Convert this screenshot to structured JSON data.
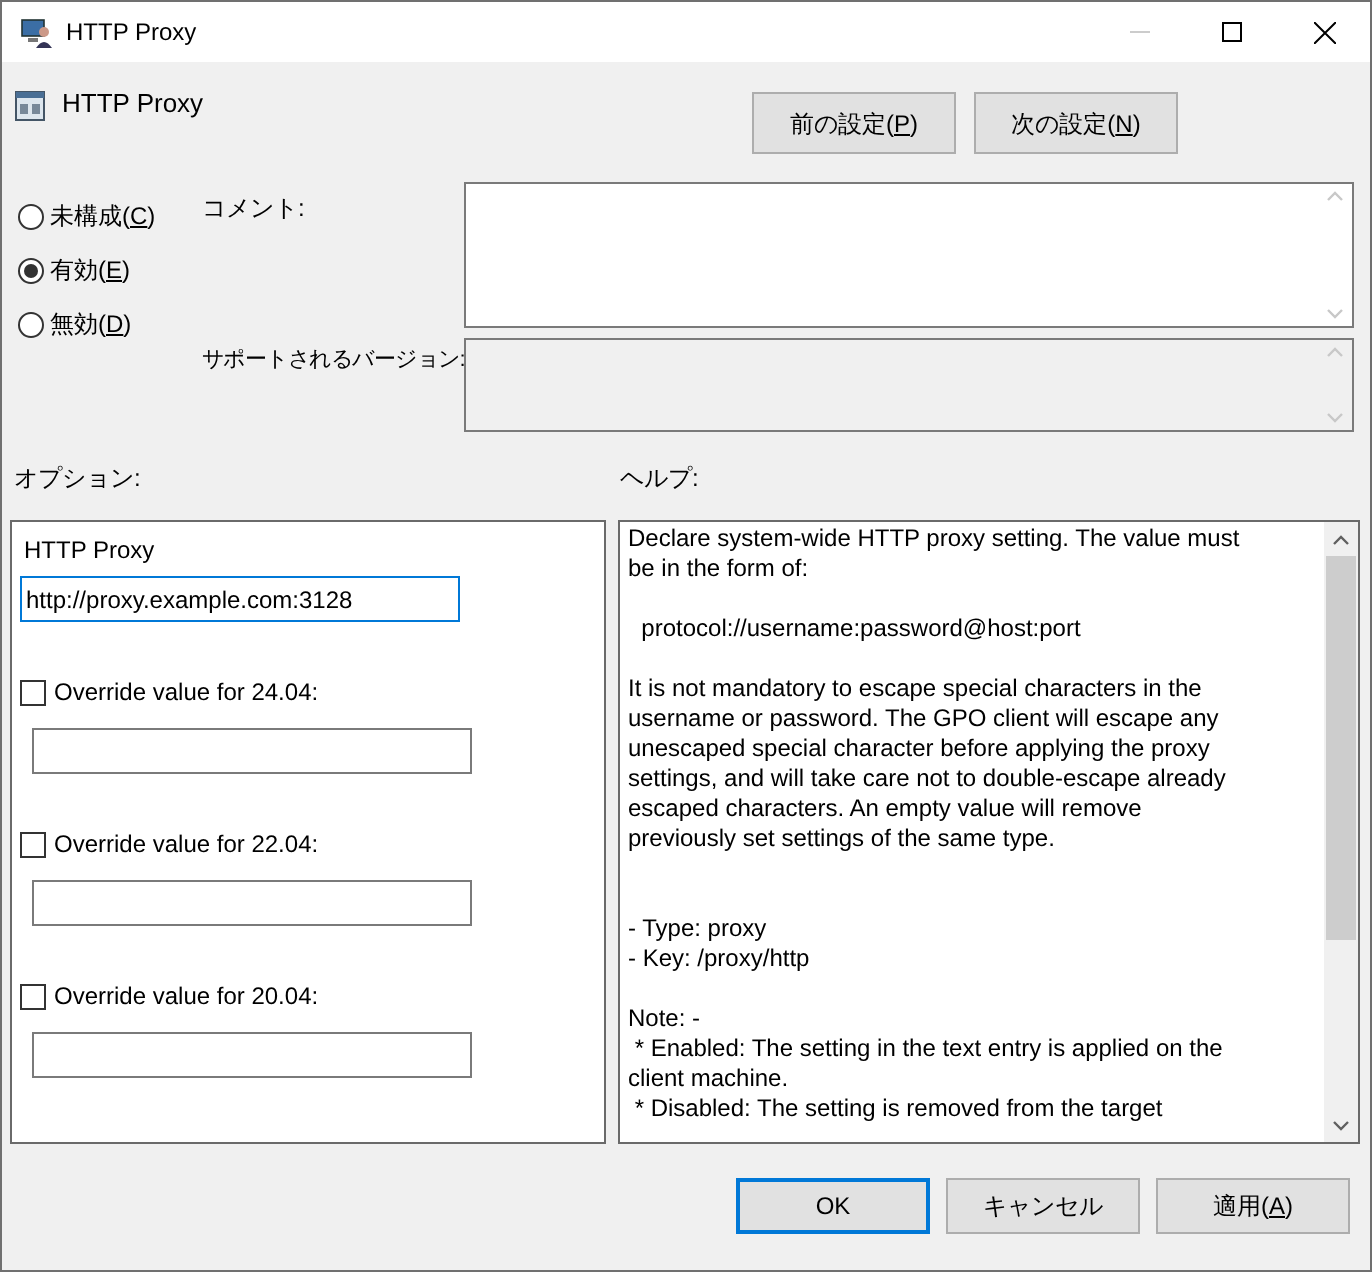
{
  "window": {
    "title": "HTTP Proxy"
  },
  "header": {
    "title": "HTTP Proxy"
  },
  "nav_buttons": [
    {
      "label": "前の設定(P)"
    },
    {
      "label": "次の設定(N)"
    }
  ],
  "state_options": [
    {
      "label": "未構成(C)",
      "selected": false
    },
    {
      "label": "有効(E)",
      "selected": true
    },
    {
      "label": "無効(D)",
      "selected": false
    }
  ],
  "comment": {
    "label": "コメント:"
  },
  "supported_versions": {
    "label": "サポートされるバージョン:"
  },
  "options": {
    "heading": "オプション:",
    "title": "HTTP Proxy",
    "value": "http://proxy.example.com:3128",
    "overrides": [
      {
        "label": "Override value for 24.04:",
        "checked": false
      },
      {
        "label": "Override value for 22.04:",
        "checked": false
      },
      {
        "label": "Override value for 20.04:",
        "checked": false
      }
    ]
  },
  "help": {
    "heading": "ヘルプ:",
    "paragraphs": [
      {
        "lines": [
          "Declare system-wide HTTP proxy setting. The value must",
          "be in the form of:"
        ]
      },
      {
        "lines": [
          "  protocol://username:password@host:port"
        ]
      },
      {
        "lines": [
          "It is not mandatory to escape special characters in the",
          "username or password. The GPO client will escape any",
          "unescaped special character before applying the proxy",
          "settings, and will take care not to double-escape already",
          "escaped characters. An empty value will remove",
          "previously set settings of the same type."
        ]
      },
      {
        "lines": [
          "- Type: proxy",
          "- Key: /proxy/http"
        ]
      },
      {
        "lines": [
          "Note: -",
          " * Enabled: The setting in the text entry is applied on the",
          "client machine.",
          " * Disabled: The setting is removed from the target"
        ]
      }
    ]
  },
  "buttons": [
    {
      "label": "OK",
      "default": true
    },
    {
      "label": "キャンセル",
      "default": false
    },
    {
      "label": "適用(A)",
      "default": false
    }
  ]
}
